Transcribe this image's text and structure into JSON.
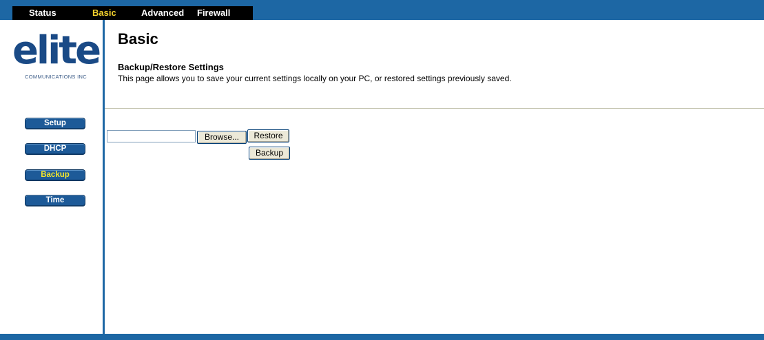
{
  "top_nav": {
    "tabs": [
      {
        "label": "Status",
        "active": false
      },
      {
        "label": "Basic",
        "active": true
      },
      {
        "label": "Advanced",
        "active": false
      },
      {
        "label": "Firewall",
        "active": false
      }
    ]
  },
  "logo": {
    "wordmark": "elite",
    "subtitle": "COMMUNICATIONS INC"
  },
  "sidebar": {
    "items": [
      {
        "label": "Setup",
        "active": false
      },
      {
        "label": "DHCP",
        "active": false
      },
      {
        "label": "Backup",
        "active": true
      },
      {
        "label": "Time",
        "active": false
      }
    ]
  },
  "main": {
    "title": "Basic",
    "section_title": "Backup/Restore Settings",
    "description": "This page allows you to save your current settings locally on your PC, or restored settings previously saved.",
    "file_input_value": "",
    "browse_label": "Browse...",
    "restore_label": "Restore",
    "backup_label": "Backup"
  },
  "colors": {
    "nav_blue": "#1d67a4",
    "active_tab": "#f2d02d",
    "button_blue": "#1d5a98"
  }
}
